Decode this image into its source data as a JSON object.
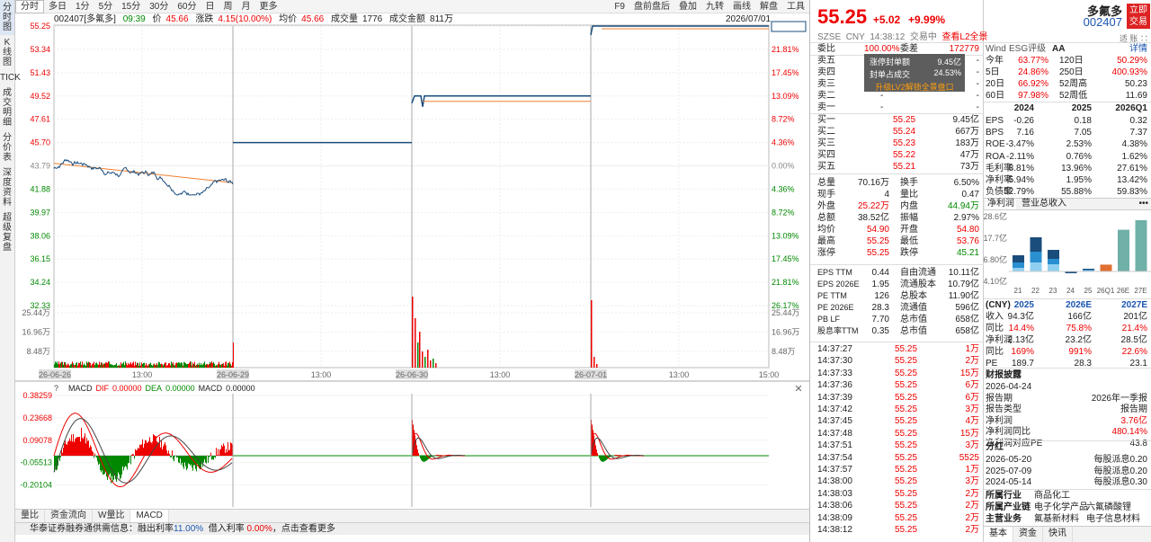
{
  "left_tabs": [
    "分时图",
    "K线图",
    "TICK",
    "成交明细",
    "分价表",
    "深度资料",
    "超级复盘"
  ],
  "period_tabs": [
    "分时",
    "多日",
    "1分",
    "5分",
    "15分",
    "30分",
    "60分",
    "日",
    "周",
    "月",
    "更多"
  ],
  "right_tools": [
    "F9",
    "盘前盘后",
    "叠加",
    "九转",
    "画线",
    "解盘",
    "工具"
  ],
  "info": {
    "code": "002407[多氟多]",
    "time": "09:39",
    "price_label": "价",
    "price": "45.66",
    "chg_label": "涨跌",
    "chg": "4.15(10.00%)",
    "avg_label": "均价",
    "avg": "45.66",
    "vol_label": "成交量",
    "vol": "1776",
    "amt_label": "成交金额",
    "amt": "811万"
  },
  "date_tr": "2026/07/01",
  "y_left": [
    "55.25",
    "53.34",
    "51.43",
    "49.52",
    "47.61",
    "45.70",
    "43.79",
    "41.88",
    "39.97",
    "38.06",
    "36.15",
    "34.24",
    "32.33"
  ],
  "y_right": [
    "26.17%",
    "21.81%",
    "17.45%",
    "13.09%",
    "8.72%",
    "4.36%",
    "0.00%",
    "4.36%",
    "8.72%",
    "13.09%",
    "17.45%",
    "21.81%",
    "26.17%"
  ],
  "vol_left": [
    "25.44万",
    "16.96万",
    "8.48万"
  ],
  "vol_right": [
    "25.44万",
    "16.96万",
    "8.48万"
  ],
  "x_labels": [
    "26-06-26",
    "13:00",
    "26-06-29",
    "13:00",
    "26-06-30",
    "13:00",
    "26-07-01",
    "13:00",
    "15:00"
  ],
  "macd": {
    "q": "?",
    "title": "MACD",
    "dif_label": "DIF",
    "dif": "0.00000",
    "dea_label": "DEA",
    "dea": "0.00000",
    "macd_label": "MACD",
    "macd": "0.00000",
    "y": [
      "0.38259",
      "0.23668",
      "0.09078",
      "-0.05513",
      "-0.20104"
    ]
  },
  "bottom_tabs": [
    "量比",
    "资金流向",
    "W量比",
    "MACD"
  ],
  "ticker": {
    "text": "华泰证券融券通供需信息：融出利率",
    "rate1": "11.00%",
    "text2": "借入利率",
    "rate2": "0.00%",
    "text3": "，点击查看更多"
  },
  "quote": {
    "price": "55.25",
    "chg": "+5.02",
    "pct": "+9.99%",
    "name": "多氟多",
    "code": "002407",
    "btn": "立即交易",
    "market": "SZSE",
    "cur": "CNY",
    "time": "14:38:12",
    "status": "交易中",
    "l2": "查看L2全景",
    "icons": "适 账 ∷"
  },
  "weibi": {
    "label1": "委比",
    "v1": "100.00%",
    "label2": "委差",
    "v2": "172779"
  },
  "sells": [
    {
      "l": "卖五",
      "p": "-",
      "v": "-"
    },
    {
      "l": "卖四",
      "p": "-",
      "v": "-"
    },
    {
      "l": "卖三",
      "p": "-",
      "v": "-"
    },
    {
      "l": "卖二",
      "p": "-",
      "v": "-"
    },
    {
      "l": "卖一",
      "p": "-",
      "v": "-"
    }
  ],
  "overlay": {
    "r1l": "涨停封单额",
    "r1v": "9.45亿",
    "r2l": "封单占成交",
    "r2v": "24.53%",
    "link": "升级LV2解锁全景盘口"
  },
  "buys": [
    {
      "l": "买一",
      "p": "55.25",
      "v": "9.45亿"
    },
    {
      "l": "买二",
      "p": "55.24",
      "v": "667万"
    },
    {
      "l": "买三",
      "p": "55.23",
      "v": "183万"
    },
    {
      "l": "买四",
      "p": "55.22",
      "v": "47万"
    },
    {
      "l": "买五",
      "p": "55.21",
      "v": "73万"
    }
  ],
  "stats": [
    [
      "总量",
      "70.16万",
      "换手",
      "6.50%"
    ],
    [
      "现手",
      "4",
      "量比",
      "0.47"
    ],
    [
      "外盘",
      "25.22万",
      "内盘",
      "44.94万"
    ],
    [
      "总额",
      "38.52亿",
      "振幅",
      "2.97%"
    ],
    [
      "均价",
      "54.90",
      "开盘",
      "54.80"
    ],
    [
      "最高",
      "55.25",
      "最低",
      "53.76"
    ],
    [
      "涨停",
      "55.25",
      "跌停",
      "45.21"
    ]
  ],
  "stats2": [
    [
      "EPS TTM",
      "0.44",
      "自由流通",
      "10.11亿"
    ],
    [
      "EPS 2026E",
      "1.95",
      "流通股本",
      "10.79亿"
    ],
    [
      "PE TTM",
      "126",
      "总股本",
      "11.90亿"
    ],
    [
      "PE 2026E",
      "28.3",
      "流通值",
      "596亿"
    ],
    [
      "PB LF",
      "7.70",
      "总市值",
      "658亿"
    ],
    [
      "股息率TTM",
      "0.35",
      "总市值",
      "658亿"
    ]
  ],
  "trades": [
    [
      "14:37:27",
      "55.25",
      "1万"
    ],
    [
      "14:37:30",
      "55.25",
      "2万"
    ],
    [
      "14:37:33",
      "55.25",
      "15万"
    ],
    [
      "14:37:36",
      "55.25",
      "6万"
    ],
    [
      "14:37:39",
      "55.25",
      "6万"
    ],
    [
      "14:37:42",
      "55.25",
      "3万"
    ],
    [
      "14:37:45",
      "55.25",
      "4万"
    ],
    [
      "14:37:48",
      "55.25",
      "15万"
    ],
    [
      "14:37:51",
      "55.25",
      "3万"
    ],
    [
      "14:37:54",
      "55.25",
      "5525"
    ],
    [
      "14:37:57",
      "55.25",
      "1万"
    ],
    [
      "14:38:00",
      "55.25",
      "3万"
    ],
    [
      "14:38:03",
      "55.25",
      "2万"
    ],
    [
      "14:38:06",
      "55.25",
      "2万"
    ],
    [
      "14:38:09",
      "55.25",
      "2万"
    ],
    [
      "14:38:12",
      "55.25",
      "2万"
    ]
  ],
  "f10": {
    "wind": "Wind",
    "esg": "ESG评级",
    "esg_v": "AA",
    "detail": "详情",
    "perf": [
      [
        "今年",
        "63.77%",
        "120日",
        "50.29%"
      ],
      [
        "5日",
        "24.86%",
        "250日",
        "400.93%"
      ],
      [
        "20日",
        "66.92%",
        "52周高",
        "50.23"
      ],
      [
        "60日",
        "97.98%",
        "52周低",
        "11.69"
      ]
    ],
    "fin_head": [
      "",
      "2024",
      "2025",
      "2026Q1"
    ],
    "fin": [
      [
        "EPS",
        "-0.26",
        "0.18",
        "0.32"
      ],
      [
        "BPS",
        "7.16",
        "7.05",
        "7.37"
      ],
      [
        "ROE",
        "-3.47%",
        "2.53%",
        "4.38%"
      ],
      [
        "ROA",
        "-2.11%",
        "0.76%",
        "1.62%"
      ],
      [
        "毛利率",
        "8.81%",
        "13.96%",
        "27.61%"
      ],
      [
        "净利率",
        "-5.94%",
        "1.95%",
        "13.42%"
      ],
      [
        "负债率",
        "52.79%",
        "55.88%",
        "59.83%"
      ]
    ],
    "tab1": "净利润",
    "tab2": "营业总收入",
    "more": "•••",
    "bar_y": [
      "28.6亿",
      "17.7亿",
      "6.80亿",
      "-4.10亿"
    ],
    "bar_x": [
      "21",
      "22",
      "23",
      "24",
      "25",
      "26Q1",
      "26E",
      "27E"
    ],
    "fc_head": [
      "(CNY)",
      "2025",
      "2026E",
      "2027E"
    ],
    "fc": [
      [
        "收入",
        "94.3亿",
        "166亿",
        "201亿"
      ],
      [
        "同比",
        "14.4%",
        "75.8%",
        "21.4%"
      ],
      [
        "净利润",
        "2.13亿",
        "23.2亿",
        "28.5亿"
      ],
      [
        "同比",
        "169%",
        "991%",
        "22.6%"
      ],
      [
        "PE",
        "189.7",
        "28.3",
        "23.1"
      ]
    ],
    "disc_title": "财报披露",
    "disc": [
      [
        "2026-04-24",
        ""
      ],
      [
        "报告期",
        "2026年一季报"
      ],
      [
        "报告类型",
        "报告期"
      ],
      [
        "净利润",
        "3.76亿"
      ],
      [
        "净利润同比",
        "480.14%"
      ],
      [
        "净利润对应PE",
        "43.8"
      ]
    ],
    "div_title": "分红",
    "div": [
      [
        "2026-05-20",
        "每股派息0.20"
      ],
      [
        "2025-07-09",
        "每股派息0.20"
      ],
      [
        "2024-05-14",
        "每股派息0.30"
      ]
    ],
    "ind": [
      [
        "所属行业",
        "商品化工",
        ""
      ],
      [
        "所属产业链",
        "电子化学产品",
        "六氟磷酸锂"
      ],
      [
        "主营业务",
        "氟基新材料",
        "电子信息材料"
      ]
    ],
    "btabs": [
      "基本",
      "资金",
      "快讯"
    ]
  },
  "chart_data": {
    "type": "line",
    "title": "",
    "x": [
      "26-06-26",
      "26-06-29",
      "26-06-30",
      "26-07-01"
    ],
    "series": [
      {
        "name": "",
        "values": [
          41.6,
          45.7,
          49.52,
          55.25
        ]
      }
    ],
    "ylim": [
      32.33,
      55.25
    ],
    "prev_close": 43.79
  }
}
